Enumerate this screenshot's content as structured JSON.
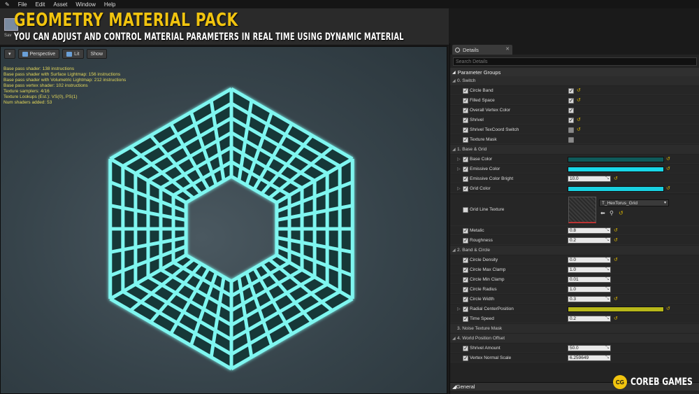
{
  "menu": [
    "File",
    "Edit",
    "Asset",
    "Window",
    "Help"
  ],
  "toolbar": {
    "save_label": "Sav"
  },
  "banner": {
    "title": "GEOMETRY MATERIAL PACK",
    "subtitle": "YOU CAN ADJUST AND CONTROL MATERIAL PARAMETERS IN REAL TIME USING DYNAMIC MATERIAL"
  },
  "viewport": {
    "buttons": {
      "perspective": "Perspective",
      "lit": "Lit",
      "show": "Show"
    },
    "stats": [
      "Base pass shader: 138 instructions",
      "Base pass shader with Surface Lightmap: 156 instructions",
      "Base pass shader with Volumetric Lightmap: 212 instructions",
      "Base pass vertex shader: 102 instructions",
      "Texture samplers: 4/16",
      "Texture Lookups (Est.): VS(0), PS(1)",
      "Num shaders added: 53"
    ],
    "glow_color": "#7ff6f0"
  },
  "details": {
    "tab_label": "Details",
    "search_placeholder": "Search Details",
    "section": "Parameter Groups",
    "groups": {
      "switch": "0. Switch",
      "base_grid": "1. Base & Grid",
      "band_circle": "2. Band & Circle",
      "noise": "3. Noise Texture Mask",
      "wpo": "4. World Position Offset"
    },
    "params": {
      "circle_band": "Circle Band",
      "filled_space": "Filled Space",
      "overall_vertex_color": "Overall Vertex Color",
      "shrivel": "Shrivel",
      "shrivel_texcoord": "Shrivel TexCoord Switch",
      "texture_mask": "Texture Mask",
      "base_color": "Base Color",
      "emissive_color": "Emissive Color",
      "emissive_bright": "Emissive Color Bright",
      "emissive_bright_val": "10.0",
      "grid_color": "Grid Color",
      "grid_line_texture": "Grid Line Texture",
      "texture_name": "T_HexTorus_Grid",
      "metalic": "Metalic",
      "metalic_val": "0.8",
      "roughness": "Roughness",
      "roughness_val": "0.2",
      "circle_density": "Circle Density",
      "circle_density_val": "0.0",
      "circle_max": "Circle Max Clamp",
      "circle_max_val": "1.0",
      "circle_min": "Circle Min Clamp",
      "circle_min_val": "0.01",
      "circle_radius": "Circle Radius",
      "circle_radius_val": "1.0",
      "circle_width": "Circle Width",
      "circle_width_val": "0.3",
      "radial_center": "Radial CenterPosition",
      "time_speed": "Time Speed",
      "time_speed_val": "0.2",
      "shrivel_amount": "Shrivel Amount",
      "shrivel_amount_val": "50.0",
      "vertex_normal_scale": "Vertex Normal Scale",
      "vertex_normal_scale_val": "6.259649"
    },
    "colors": {
      "base": "#0f5a5a",
      "emissive": "#19d8e8",
      "grid": "#19d0e0",
      "radial": "#b8b81a"
    },
    "general": "General"
  },
  "brand": {
    "logo": "CG",
    "name": "COREB GAMES"
  }
}
